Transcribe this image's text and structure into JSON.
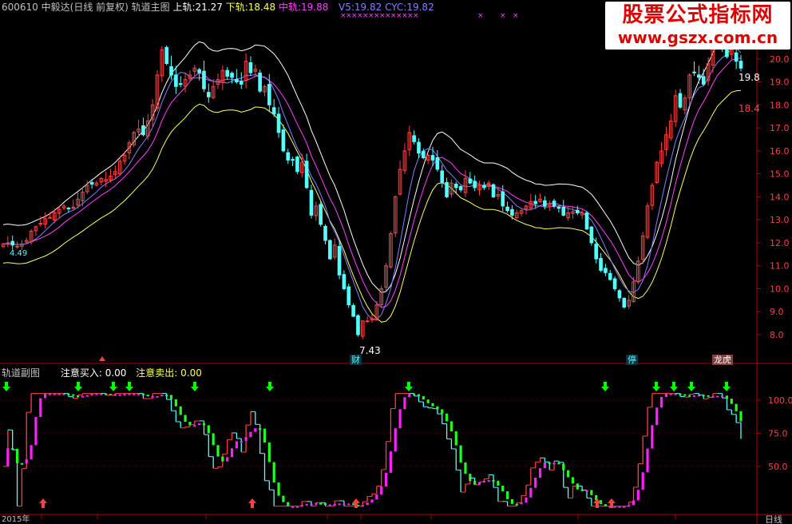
{
  "header": {
    "code": "600610",
    "name": "中毅达(日线 前复权)",
    "indicator": "轨道主图",
    "upper_label": "上轨:",
    "upper_value": "21.27",
    "lower_label": "下轨:",
    "lower_value": "18.48",
    "mid_label": "中轨:",
    "mid_value": "19.88",
    "v5_label": "V5:",
    "v5_value": "19.82",
    "cyc_label": "CYC:",
    "cyc_value": "19.82"
  },
  "watermark": {
    "line1": "股票公式指标网",
    "line2": "www.gszx.com.cn"
  },
  "sub_header": {
    "title": "轨道副图",
    "buy_label": "注意买入:",
    "buy_value": "0.00",
    "sell_label": "注意卖出:",
    "sell_value": "0.00"
  },
  "badges": {
    "cai": "财",
    "ting": "停",
    "longhu": "龙虎"
  },
  "annotations": {
    "low_price": "7.43",
    "last_mid": "19.8",
    "last_low": "18.4",
    "left_price": "4.49"
  },
  "bottom_axis": {
    "left": "2015年",
    "right": "日线"
  },
  "colors": {
    "up": "#ff4040",
    "down": "#54ffff",
    "upper": "#ffffff",
    "lower": "#ffff60",
    "mid": "#ff40ff",
    "cyc": "#8080ff",
    "buy_arrow": "#ff4040",
    "sell_arrow": "#00ff00"
  },
  "chart_data": [
    {
      "type": "candlestick",
      "title": "轨道主图",
      "y_ticks": [
        8.0,
        9.0,
        10.0,
        11.0,
        12.0,
        13.0,
        14.0,
        15.0,
        16.0,
        17.0,
        18.0,
        19.0,
        20.0,
        21.0
      ],
      "ylim": [
        7.2,
        21.8
      ],
      "closes": [
        11.95,
        12.0,
        11.9,
        11.85,
        11.95,
        12.1,
        12.5,
        12.7,
        12.85,
        13.05,
        13.1,
        13.3,
        13.45,
        13.6,
        13.5,
        13.55,
        13.9,
        14.2,
        14.5,
        14.55,
        14.6,
        14.8,
        14.75,
        14.9,
        15.1,
        15.55,
        15.8,
        16.35,
        16.8,
        16.95,
        16.7,
        17.3,
        18.0,
        19.3,
        20.4,
        19.8,
        19.3,
        18.8,
        18.9,
        19.1,
        19.3,
        19.6,
        19.4,
        18.7,
        18.35,
        18.8,
        19.1,
        19.5,
        19.25,
        19.2,
        19.0,
        18.9,
        19.9,
        19.4,
        19.55,
        18.6,
        18.8,
        18.0,
        17.6,
        16.8,
        16.0,
        15.6,
        15.6,
        15.1,
        15.5,
        14.4,
        13.2,
        13.6,
        12.8,
        12.1,
        11.3,
        11.9,
        10.6,
        10.0,
        9.3,
        8.8,
        8.0,
        8.6,
        8.6,
        8.7,
        9.3,
        10.0,
        11.0,
        12.4,
        14.0,
        15.2,
        16.0,
        16.8,
        16.4,
        15.9,
        15.7,
        15.8,
        15.6,
        15.2,
        14.6,
        14.0,
        14.6,
        14.4,
        14.3,
        14.8,
        14.6,
        14.4,
        14.5,
        14.4,
        14.6,
        14.0,
        14.1,
        13.6,
        13.4,
        13.2,
        13.3,
        13.4,
        13.6,
        13.8,
        13.7,
        13.9,
        13.6,
        13.7,
        13.6,
        13.5,
        13.2,
        13.3,
        13.35,
        13.3,
        13.3,
        12.6,
        12.0,
        11.3,
        10.8,
        10.7,
        10.4,
        10.0,
        9.6,
        9.2,
        9.5,
        10.3,
        11.2,
        12.3,
        13.6,
        14.5,
        15.5,
        16.0,
        16.7,
        17.3,
        18.4,
        17.9,
        18.3,
        19.3,
        19.4,
        19.2,
        18.9,
        19.8,
        20.8,
        21.0,
        20.6,
        20.1,
        20.4,
        19.9,
        19.6
      ],
      "series_names": [
        "上轨",
        "下轨",
        "中轨",
        "V5",
        "CYC"
      ]
    },
    {
      "type": "line",
      "title": "轨道副图",
      "y_ticks": [
        50.0,
        75.0,
        100.0
      ],
      "ylim": [
        15,
        115
      ]
    }
  ]
}
